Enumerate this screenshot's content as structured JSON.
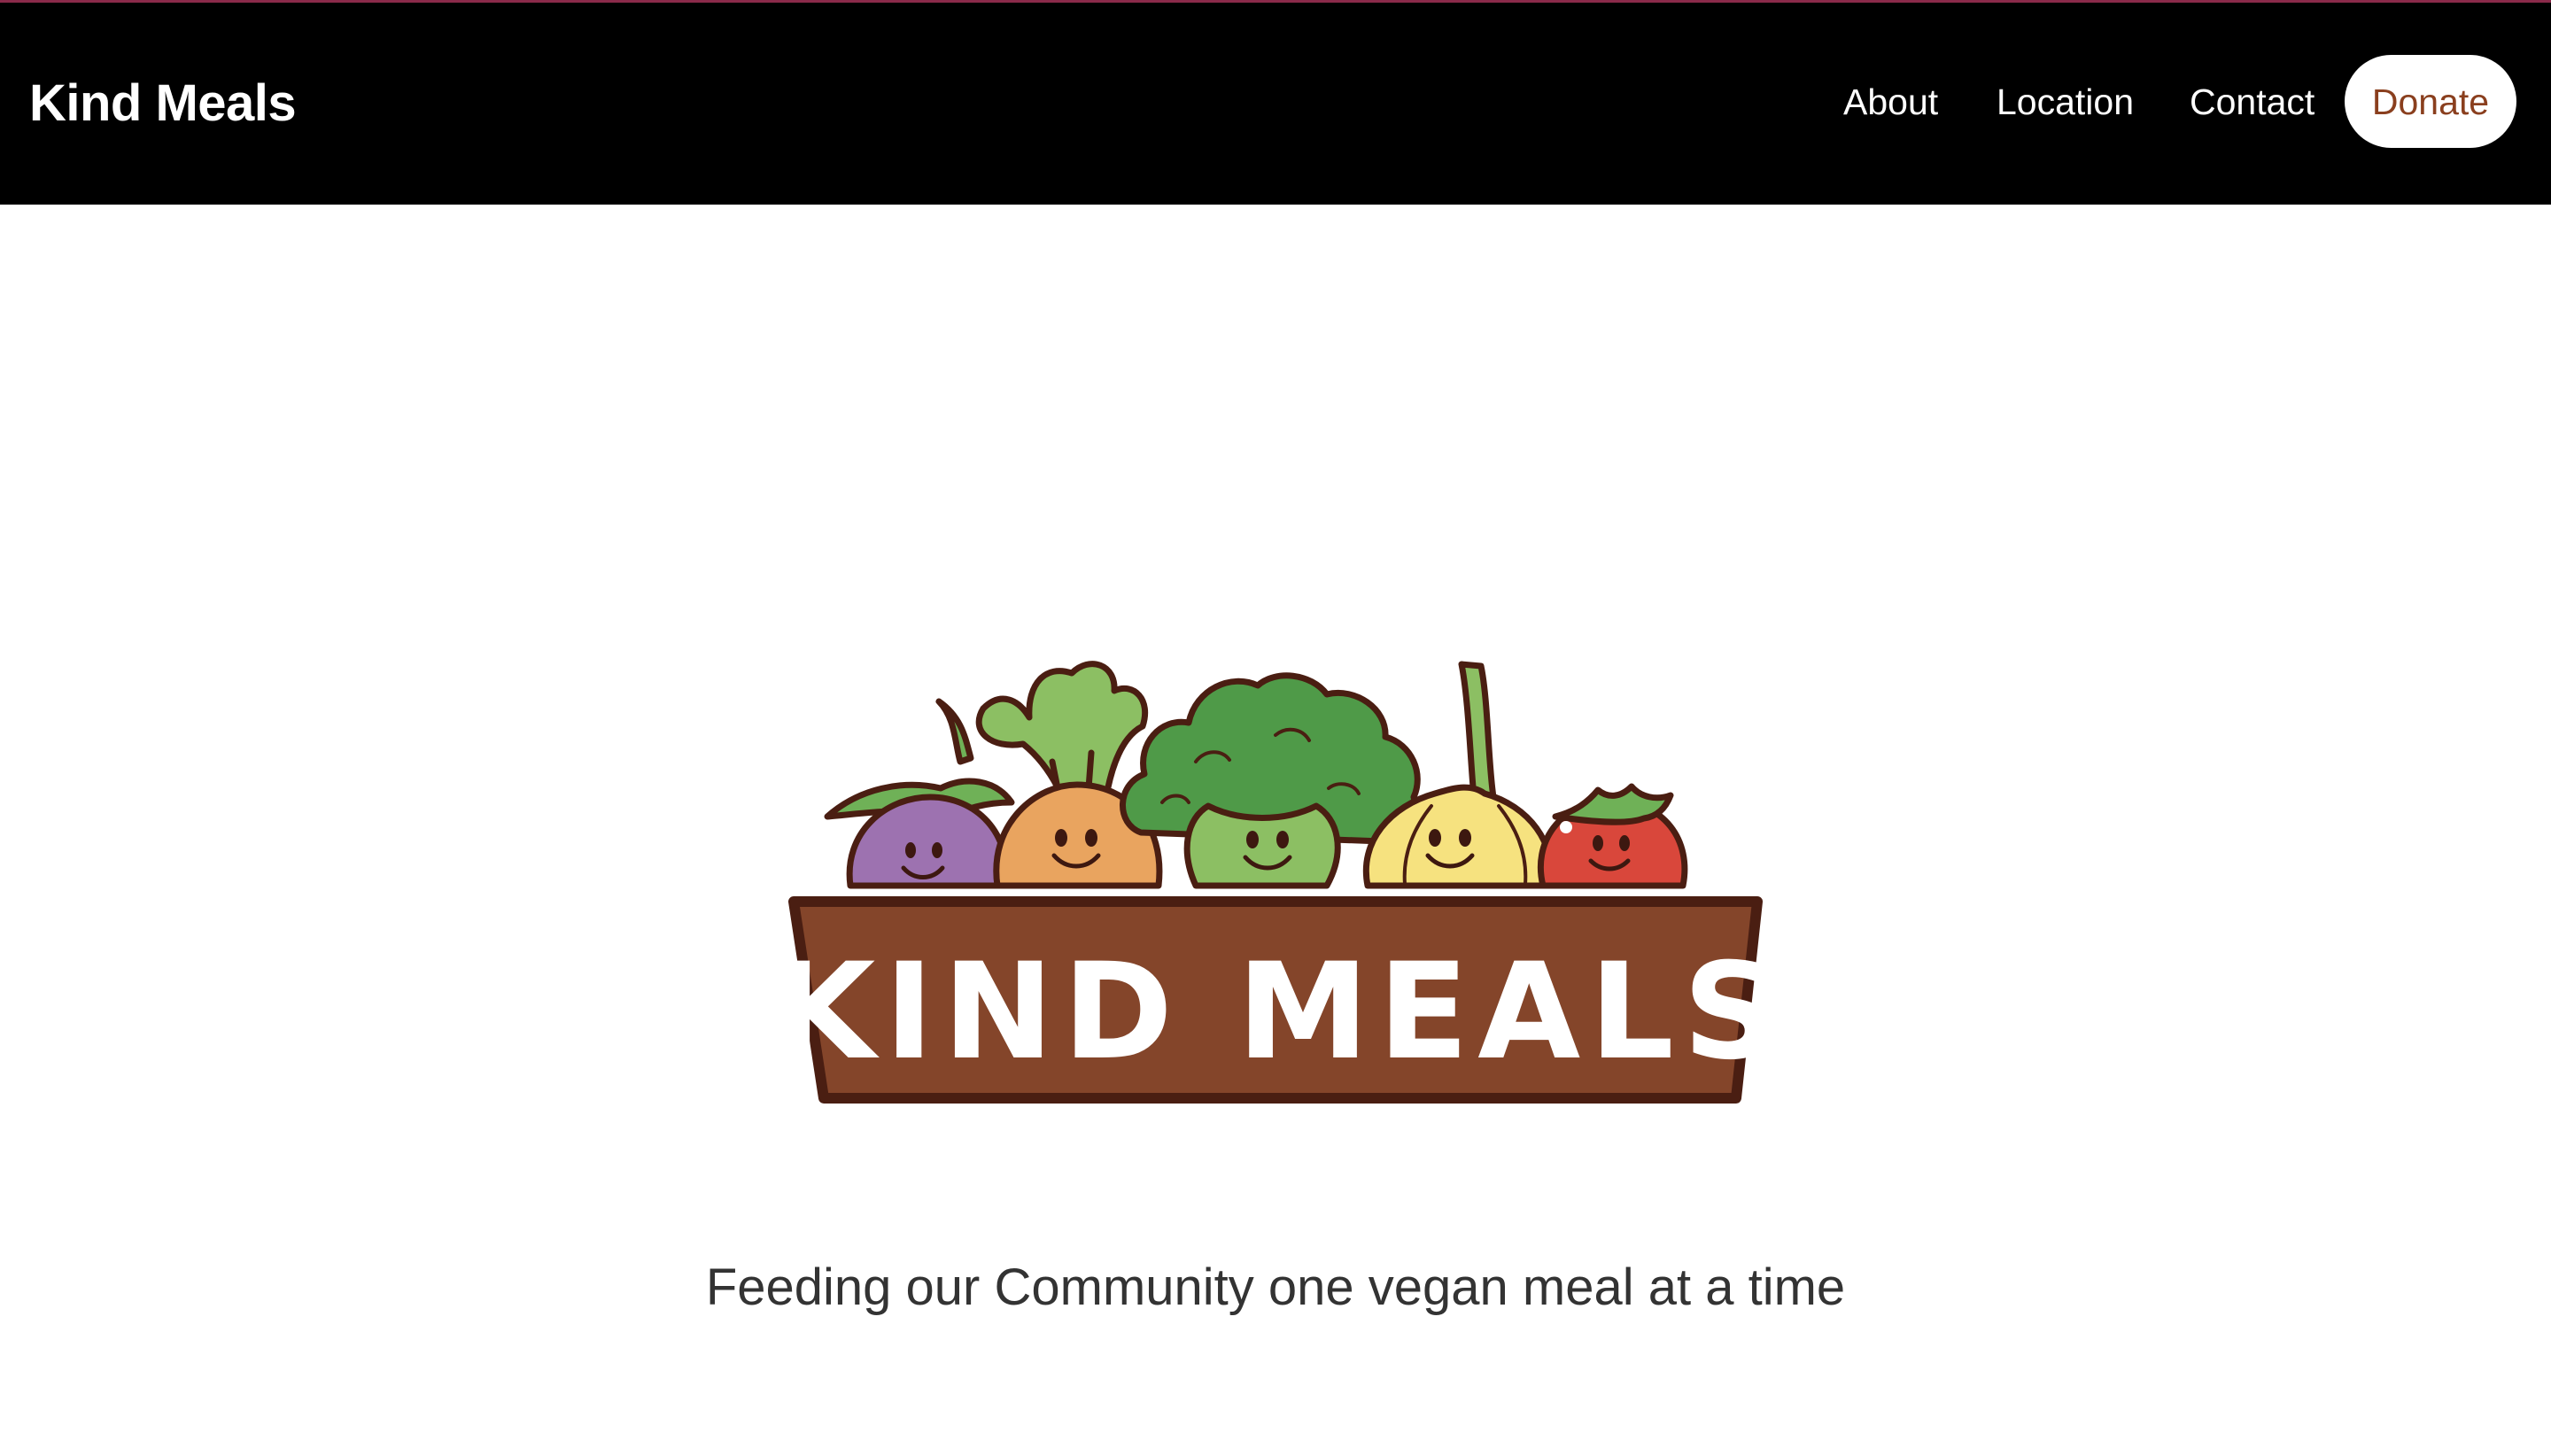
{
  "nav": {
    "brand": "Kind Meals",
    "links": [
      "About",
      "Location",
      "Contact"
    ],
    "donate_label": "Donate"
  },
  "hero": {
    "logo_text": "KIND MEALS",
    "tagline": "Feeding our Community one vegan meal at a time"
  },
  "colors": {
    "navbar_bg": "#000000",
    "donate_text": "#8a3f1e",
    "crate_brown": "#84452a",
    "eggplant": "#9d72b0",
    "carrot": "#e9a45f",
    "broccoli": "#8cbf63",
    "onion": "#f6e27f",
    "tomato": "#d9473b"
  }
}
